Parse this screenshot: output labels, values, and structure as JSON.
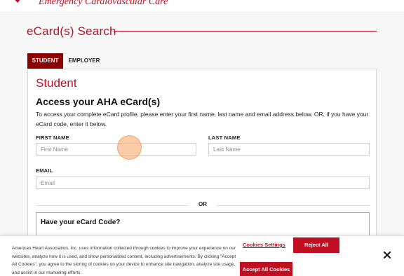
{
  "header": {
    "subtitle": "Emergency Cardiovascular Care"
  },
  "page": {
    "title": "eCard(s) Search"
  },
  "tabs": [
    {
      "label": "STUDENT",
      "active": true
    },
    {
      "label": "EMPLOYER",
      "active": false
    }
  ],
  "form": {
    "section_title": "Student",
    "heading": "Access your AHA eCard(s)",
    "instructions": "To access your complete eCard profile, please enter your first name, last name and email address below. OR, if you have your eCard code, enter it below.",
    "first_name": {
      "label": "FIRST NAME",
      "placeholder": "First Name",
      "value": ""
    },
    "last_name": {
      "label": "LAST NAME",
      "placeholder": "Last Name",
      "value": ""
    },
    "email": {
      "label": "EMAIL",
      "placeholder": "Email",
      "value": ""
    },
    "or_label": "OR",
    "code_section_title": "Have your eCard Code?"
  },
  "cookie_banner": {
    "text": "American Heart Association, Inc. uses information collected through cookies to improve your experience on our websites, analyze how it is used, and show personalized content, including advertisements. By clicking \"Accept All Cookies\", you agree to the storing of cookies on your device to enhance site navigation, analyze site usage, and assist in our marketing efforts.",
    "settings_label": "Cookies Settings",
    "reject_label": "Reject All",
    "accept_label": "Accept All Cookies",
    "close_icon": "close-icon"
  },
  "colors": {
    "brand_red": "#c10e21",
    "tab_active": "#8b0000",
    "page_background": "#f7f7f7"
  }
}
